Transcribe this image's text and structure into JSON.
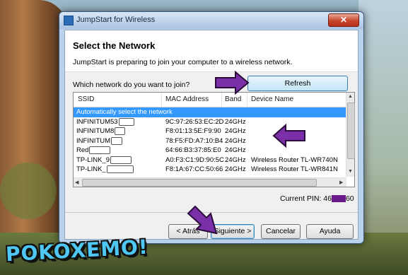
{
  "window": {
    "title": "JumpStart for Wireless",
    "close_glyph": "✕"
  },
  "header": {
    "title": "Select the Network",
    "subtitle": "JumpStart is preparing to join your computer to a wireless network."
  },
  "question": "Which network do you want to join?",
  "refresh_label": "Refresh",
  "table": {
    "columns": [
      "SSID",
      "MAC Address",
      "Band",
      "Device Name"
    ],
    "rows": [
      {
        "ssid": "Automatically select the network",
        "mac": "",
        "band": "",
        "device": "",
        "selected": true
      },
      {
        "ssid": "INFINITUM53",
        "mac": "9C:97:26:53:EC:2D",
        "band": "24GHz",
        "device": ""
      },
      {
        "ssid": "INFINITUM8",
        "mac": "F8:01:13:5E:F9:90",
        "band": "24GHz",
        "device": ""
      },
      {
        "ssid": "INFINITUM",
        "mac": "78:F5:FD:A7:10:B4",
        "band": "24GHz",
        "device": ""
      },
      {
        "ssid": "Red",
        "mac": "64:66:B3:37:85:E0",
        "band": "24GHz",
        "device": ""
      },
      {
        "ssid": "TP-LINK_9",
        "mac": "A0:F3:C1:9D:90:5C",
        "band": "24GHz",
        "device": "Wireless Router TL-WR740N"
      },
      {
        "ssid": "TP-LINK_",
        "mac": "F8:1A:67:CC:50:66",
        "band": "24GHz",
        "device": "Wireless Router TL-WR841N"
      }
    ]
  },
  "pin": {
    "label": "Current PIN: 46",
    "suffix": "60"
  },
  "buttons": {
    "back": "< Atrás",
    "next": "Siguiente >",
    "cancel": "Cancelar",
    "help": "Ayuda"
  },
  "watermark": "POKOXEMO!",
  "colors": {
    "selection": "#3399ff",
    "annotation_arrow": "#7b2fa8",
    "watermark": "#4ec7f2"
  }
}
